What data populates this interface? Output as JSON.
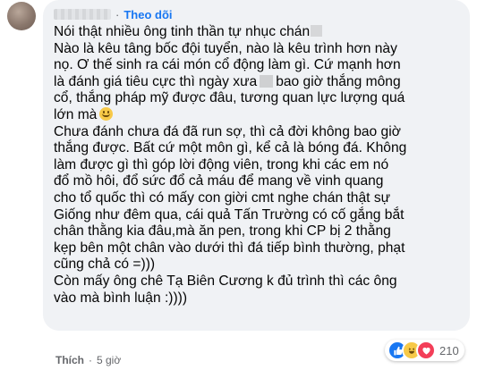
{
  "comment": {
    "follow_label": "Theo dõi",
    "separator": "·",
    "lines": [
      "Nói thật nhiều ông tinh thần tự nhục chán",
      "Nào là kêu tâng bốc đội tuyển, nào là kêu trình hơn này",
      "nọ. Ơ thế sinh ra cái món cổ động làm gì. Cứ mạnh hơn",
      "là đánh giá tiêu cực thì ngày xưa",
      "bao giờ thắng mông",
      "cổ, thắng pháp mỹ được đâu, tương quan lực lượng quá",
      "lớn mà",
      "Chưa đánh chưa đá đã run sợ, thì cả đời không bao giờ",
      "thắng được. Bất cứ một môn gì, kể cả là bóng đá. Không",
      "làm được gì thì góp lời động viên, trong khi các em nó",
      "đổ mồ hôi, đổ sức đổ cả máu để mang về vinh quang",
      "cho tổ quốc thì có mấy con giời cmt nghe chán thật sự",
      "Giống như đêm qua, cái quả Tấn Trường có cố gắng bắt",
      "chân thằng kia đâu,mà ăn pen, trong khi CP bị 2 thằng",
      "kẹp bên một chân vào dưới thì đá tiếp bình thường, phạt",
      "cũng chả có =)))",
      "Còn mấy ông chê Tạ Biên Cương k đủ trình thì các ông",
      "vào mà bình luận :))))"
    ],
    "reaction_count": "210",
    "like_label": "Thích",
    "time": "5 giờ",
    "reaction_icons": [
      "like-icon",
      "haha-icon",
      "love-icon"
    ]
  }
}
